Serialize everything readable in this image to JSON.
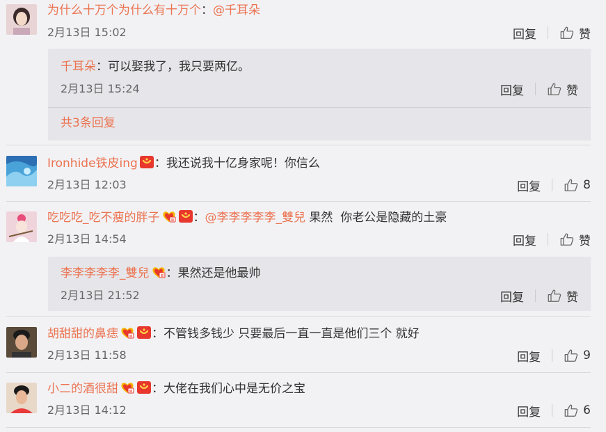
{
  "comments": [
    {
      "user": "为什么十万个为什么有十万个",
      "text": "@千耳朵",
      "time": "2月13日 15:02",
      "reply_label": "回复",
      "like_label": "赞",
      "replies": [
        {
          "user": "千耳朵",
          "text": "可以娶我了，我只要两亿。",
          "time": "2月13日 15:24",
          "reply_label": "回复",
          "like_label": "赞"
        }
      ],
      "more_replies": "共3条回复"
    },
    {
      "user": "Ironhide铁皮ing",
      "text": "我还说我十亿身家呢！你信么",
      "time": "2月13日 12:03",
      "reply_label": "回复",
      "like_count": "8"
    },
    {
      "user": "吃吃吃_吃不瘦的胖子",
      "mention": "@李李李李李_雙兒",
      "text": " 果然  你老公是隐藏的土豪",
      "time": "2月13日 14:54",
      "reply_label": "回复",
      "like_label": "赞",
      "replies": [
        {
          "user": "李李李李李_雙兒",
          "text": "果然还是他最帅",
          "time": "2月13日 21:52",
          "reply_label": "回复",
          "like_label": "赞"
        }
      ]
    },
    {
      "user": "胡甜甜的鼻痣",
      "text": "不管钱多钱少 只要最后一直一直是他们三个 就好",
      "time": "2月13日 11:58",
      "reply_label": "回复",
      "like_count": "9"
    },
    {
      "user": "小二的酒很甜",
      "text": "大佬在我们心中是无价之宝",
      "time": "2月13日 14:12",
      "reply_label": "回复",
      "like_count": "6"
    }
  ],
  "colon": "：",
  "colors": {
    "accent": "#eb7350",
    "background": "#f2f2f5",
    "reply_box": "#e6e6ea"
  }
}
